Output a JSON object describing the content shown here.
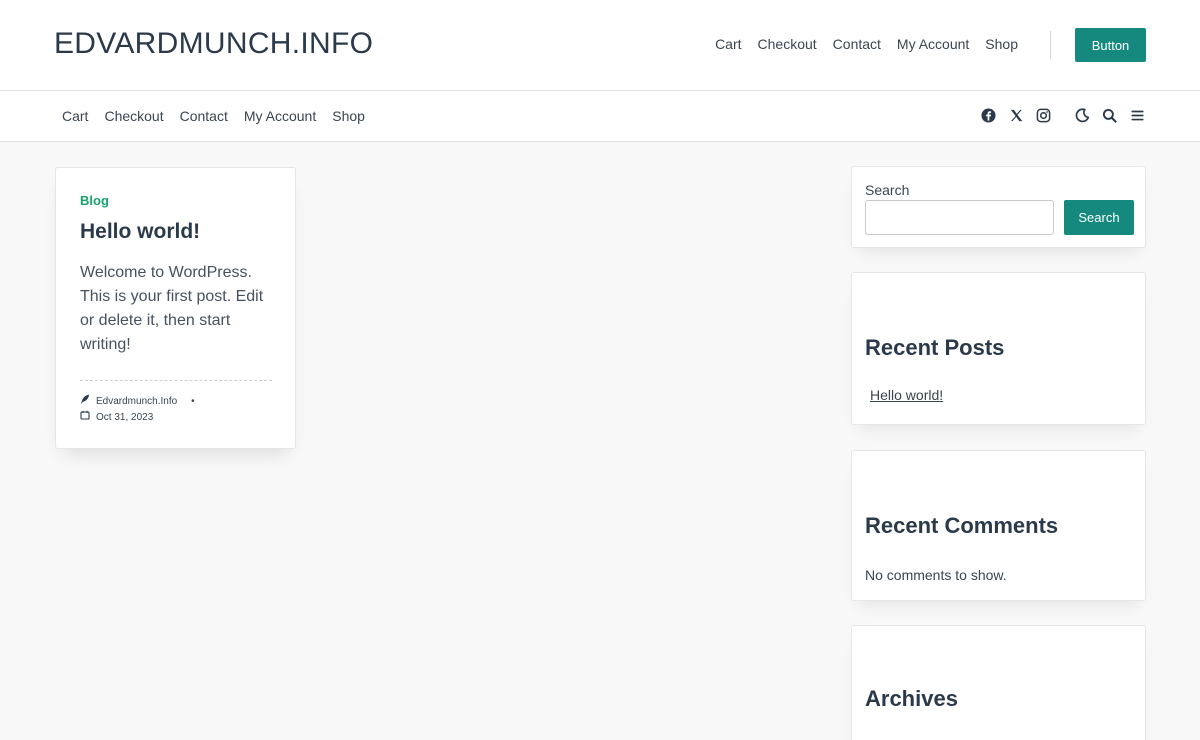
{
  "site": {
    "title": "EDVARDMUNCH.INFO"
  },
  "top_nav": [
    "Cart",
    "Checkout",
    "Contact",
    "My Account",
    "Shop"
  ],
  "top_button": "Button",
  "sub_nav": [
    "Cart",
    "Checkout",
    "Contact",
    "My Account",
    "Shop"
  ],
  "icons": [
    "facebook-icon",
    "x-twitter-icon",
    "instagram-icon",
    "dark-mode-moon-icon",
    "search-icon",
    "menu-hamburger-icon"
  ],
  "post": {
    "category": "Blog",
    "title": "Hello world!",
    "excerpt": "Welcome to WordPress. This is your first post. Edit or delete it, then start writing!",
    "author": "Edvardmunch.Info",
    "date": "Oct 31, 2023"
  },
  "search_widget": {
    "label": "Search",
    "value": "",
    "button": "Search"
  },
  "recent_posts": {
    "heading": "Recent Posts",
    "items": [
      "Hello world!"
    ]
  },
  "recent_comments": {
    "heading": "Recent Comments",
    "empty_text": "No comments to show."
  },
  "archives": {
    "heading": "Archives"
  },
  "colors": {
    "accent": "#16897e",
    "category": "#16a36e",
    "text": "#2b3a4a",
    "background": "#f8f8f8"
  }
}
